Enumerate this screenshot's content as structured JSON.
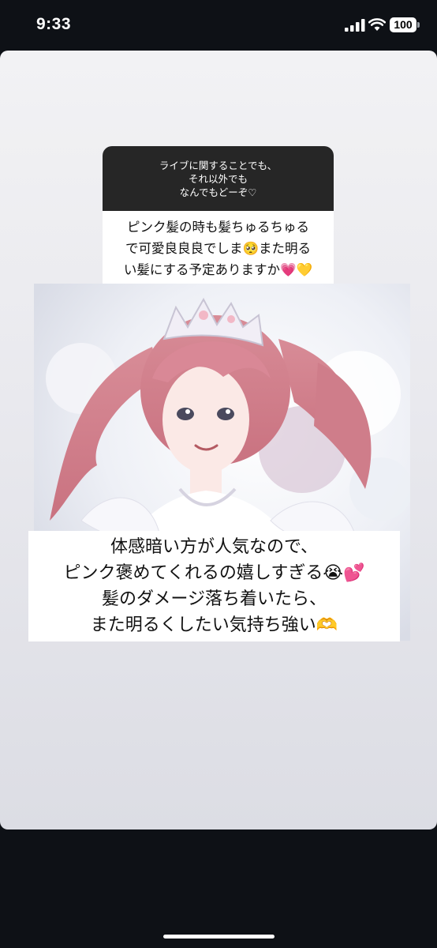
{
  "status_bar": {
    "time": "9:33",
    "battery_level": "100",
    "signal_icon": "cellular-signal-icon",
    "wifi_icon": "wifi-icon"
  },
  "question": {
    "prompt_lines": [
      "ライブに関することでも、",
      "それ以外でも",
      "なんでもどーぞ♡"
    ],
    "answer_lines": [
      "ピンク髪の時も髪ちゅるちゅる",
      "で可愛良良良でしま🥺また明る",
      "い髪にする予定ありますか💗💛"
    ]
  },
  "caption": {
    "lines": [
      "体感暗い方が人気なので、",
      "ピンク褒めてくれるの嬉しすぎる😭💕",
      "髪のダメージ落ち着いたら、",
      "また明るくしたい気持ち強い🫶"
    ]
  },
  "colors": {
    "background": "#0e1116",
    "question_header": "#262626",
    "card": "#ffffff"
  }
}
